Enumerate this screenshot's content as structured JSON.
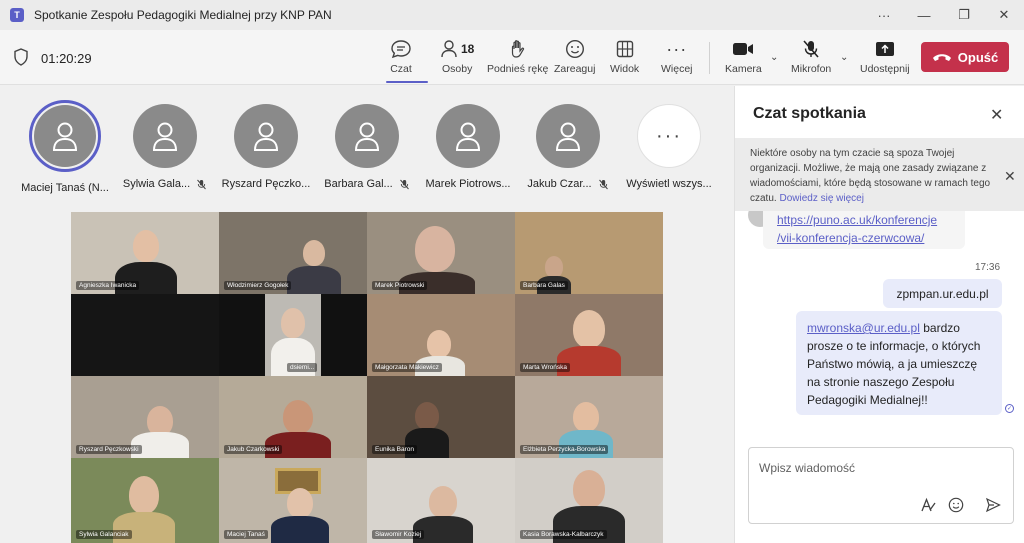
{
  "window": {
    "title": "Spotkanie Zespołu Pedagogiki Medialnej przy KNP PAN",
    "controls": {
      "more": "···",
      "minimize": "—",
      "restore": "❐",
      "close": "✕"
    }
  },
  "toolbar": {
    "timer": "01:20:29",
    "chat_label": "Czat",
    "people_label": "Osoby",
    "people_count": "18",
    "raise_hand_label": "Podnieś rękę",
    "react_label": "Zareaguj",
    "view_label": "Widok",
    "more_label": "Więcej",
    "camera_label": "Kamera",
    "mic_label": "Mikrofon",
    "share_label": "Udostępnij",
    "leave_label": "Opuść"
  },
  "participants": [
    {
      "name": "Maciej Tanaś (N...",
      "muted": false,
      "active": true
    },
    {
      "name": "Sylwia Gala...",
      "muted": true
    },
    {
      "name": "Ryszard Pęczko...",
      "muted": false
    },
    {
      "name": "Barbara Gal...",
      "muted": true
    },
    {
      "name": "Marek Piotrows...",
      "muted": false
    },
    {
      "name": "Jakub Czar...",
      "muted": true
    },
    {
      "name": "Wyświetl wszys...",
      "more": true
    }
  ],
  "video_tiles": [
    {
      "name": "Agnieszka Iwanicka"
    },
    {
      "name": "Włodzimierz Gogołek"
    },
    {
      "name": "Marek Piotrowski"
    },
    {
      "name": "Barbara Galas"
    },
    {
      "name": "dsiemi..."
    },
    {
      "name": "Małgorzata Makiewicz"
    },
    {
      "name": "Marta Wrońska"
    },
    {
      "name": "Ryszard Pęczkowski"
    },
    {
      "name": "Jakub Czarkowski"
    },
    {
      "name": "Eunika Baron"
    },
    {
      "name": "Elżbieta Perzycka-Borowska"
    },
    {
      "name": "Sylwia Galanciak"
    },
    {
      "name": "Maciej Tanaś"
    },
    {
      "name": "Sławomir Koziej"
    },
    {
      "name": "Kasia Borawska-Kalbarczyk"
    }
  ],
  "chat": {
    "title": "Czat spotkania",
    "notice": "Niektóre osoby na tym czacie są spoza Twojej organizacji. Możliwe, że mają one zasady związane z wiadomościami, które będą stosowane w ramach tego czatu.",
    "notice_link": "Dowiedz się więcej",
    "incoming_link_line1": "https://puno.ac.uk/konferencje",
    "incoming_link_line2": "/vii-konferencja-czerwcowa/",
    "timestamp": "17:36",
    "out_msg1": "zpmpan.ur.edu.pl",
    "out_msg2_link": "mwronska@ur.edu.pl",
    "out_msg2_text": " bardzo prosze o te informacje, o których Państwo mówią, a ja umieszczę na stronie naszego Zespołu Pedagogiki Medialnej!!",
    "compose_placeholder": "Wpisz wiadomość"
  }
}
